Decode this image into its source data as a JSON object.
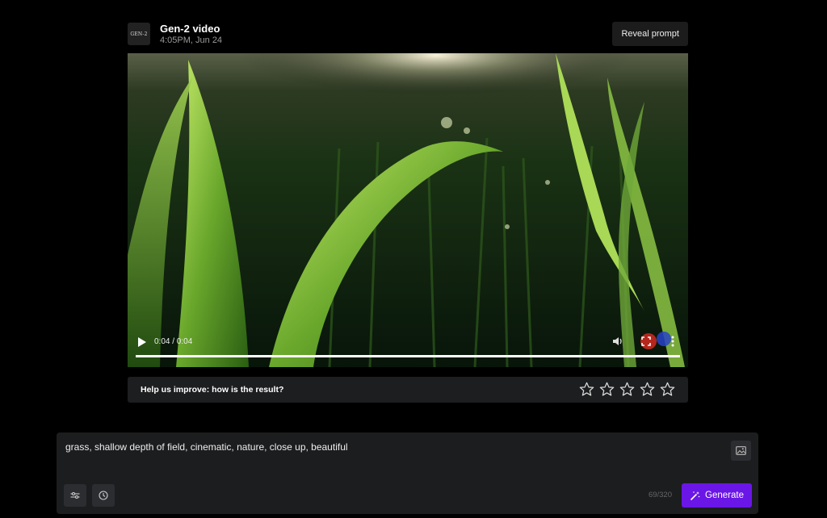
{
  "header": {
    "logo_text": "GEN-2",
    "title": "Gen-2 video",
    "timestamp": "4:05PM, Jun 24",
    "reveal_prompt_label": "Reveal prompt"
  },
  "video": {
    "time_display": "0:04 / 0:04",
    "progress": 1.0,
    "icons": [
      "play-icon",
      "volume-icon",
      "fullscreen-icon",
      "more-options-icon"
    ]
  },
  "feedback": {
    "question": "Help us improve: how is the result?",
    "star_count": 5,
    "rating": 0
  },
  "prompt": {
    "text": "grass, shallow depth of field, cinematic, nature, close up, beautiful",
    "char_count": "69/320",
    "generate_label": "Generate"
  },
  "colors": {
    "accent": "#6a16e6",
    "background": "#000000",
    "panel": "#1c1d1f"
  }
}
